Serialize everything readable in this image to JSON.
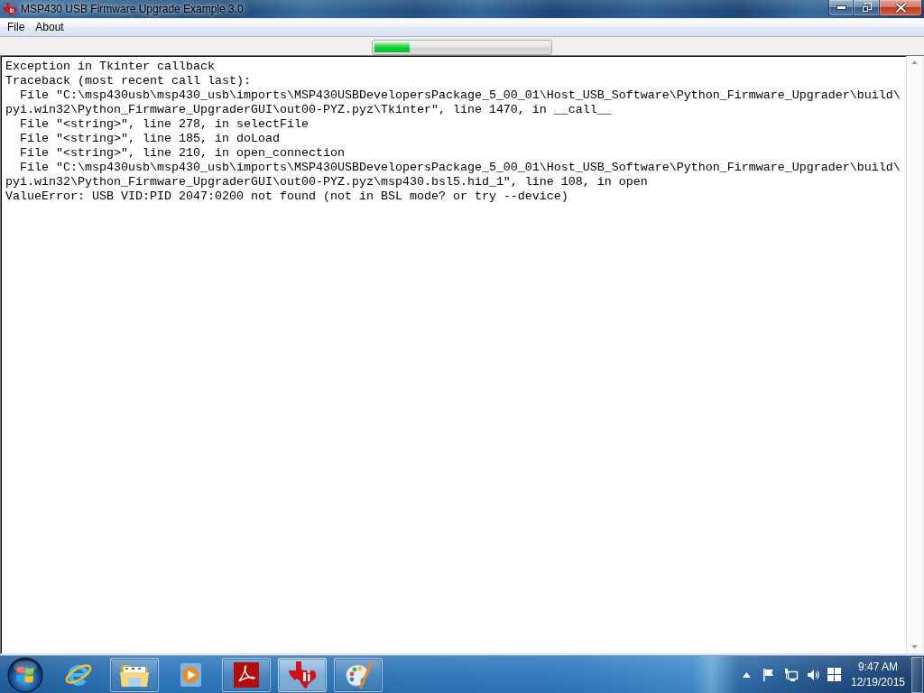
{
  "window": {
    "title": "MSP430 USB Firmware Upgrade Example 3.0"
  },
  "menu": [
    {
      "label": "File"
    },
    {
      "label": "About"
    }
  ],
  "progress": {
    "level": 0.2
  },
  "console": {
    "lines": [
      "Exception in Tkinter callback",
      "Traceback (most recent call last):",
      "  File \"C:\\msp430usb\\msp430_usb\\imports\\MSP430USBDevelopersPackage_5_00_01\\Host_USB_Software\\Python_Firmware_Upgrader\\build\\",
      "pyi.win32\\Python_Firmware_UpgraderGUI\\out00-PYZ.pyz\\Tkinter\", line 1470, in __call__",
      "  File \"<string>\", line 278, in selectFile",
      "  File \"<string>\", line 185, in doLoad",
      "  File \"<string>\", line 210, in open_connection",
      "  File \"C:\\msp430usb\\msp430_usb\\imports\\MSP430USBDevelopersPackage_5_00_01\\Host_USB_Software\\Python_Firmware_Upgrader\\build\\",
      "pyi.win32\\Python_Firmware_UpgraderGUI\\out00-PYZ.pyz\\msp430.bsl5.hid_1\", line 108, in open",
      "ValueError: USB VID:PID 2047:0200 not found (not in BSL mode? or try --device)"
    ]
  },
  "taskbar": {
    "apps": [
      {
        "kind": "browser",
        "running": false,
        "selected": false
      },
      {
        "kind": "folder",
        "running": true,
        "selected": false
      },
      {
        "kind": "media",
        "running": false,
        "selected": false
      },
      {
        "kind": "pdf",
        "running": true,
        "selected": false
      },
      {
        "kind": "logo",
        "running": true,
        "selected": true
      },
      {
        "kind": "paint",
        "running": true,
        "selected": false
      }
    ],
    "clock": {
      "time": "9:47 AM",
      "date": "12/19/2015"
    }
  }
}
